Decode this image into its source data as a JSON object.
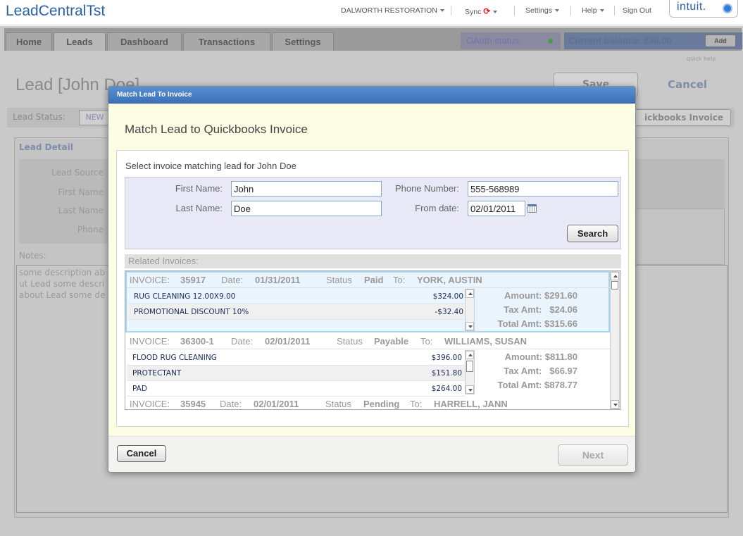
{
  "app_title": "LeadCentralTst",
  "topnav": {
    "company": "DALWORTH RESTORATION",
    "sync": "Sync",
    "settings": "Settings",
    "help": "Help",
    "sign_out": "Sign Out",
    "logo": "intuit."
  },
  "nav_tabs": [
    "Home",
    "Leads",
    "Dashboard",
    "Transactions",
    "Settings"
  ],
  "oauth_label": "OAuth status:",
  "balance": {
    "label": "Current balance:",
    "value": "$38.00",
    "add": "Add"
  },
  "quick_help": "quick help",
  "background": {
    "lead_title": "Lead [John Doe]",
    "save": "Save",
    "cancel": "Cancel",
    "lead_status_label": "Lead Status:",
    "lead_status_value": "NEW",
    "qb_invoice": "ickbooks Invoice",
    "lead_detail": "Lead Detail",
    "fields": [
      "Lead Source",
      "First Name",
      "Last Name",
      "Phone"
    ],
    "notes_label": "Notes:",
    "notes_lines": [
      "some description ab",
      "ut Lead some descri",
      "about Lead some de"
    ]
  },
  "modal": {
    "title": "Match Lead To Invoice",
    "heading": "Match Lead to Quickbooks Invoice",
    "select_label": "Select invoice matching lead for John Doe",
    "first_name_label": "First Name:",
    "first_name": "John",
    "last_name_label": "Last Name:",
    "last_name": "Doe",
    "phone_label": "Phone Number:",
    "phone": "555-568989",
    "from_date_label": "From date:",
    "from_date": "02/01/2011",
    "search": "Search",
    "related_label": "Related Invoices:",
    "cancel": "Cancel",
    "next": "Next"
  },
  "labels": {
    "invoice": "INVOICE:",
    "date": "Date:",
    "status": "Status",
    "to": "To:",
    "amount": "Amount:",
    "tax": "Tax Amt:",
    "total": "Total Amt:"
  },
  "invoices": [
    {
      "number": "35917",
      "date": "01/31/2011",
      "status": "Paid",
      "to": "YORK, AUSTIN",
      "lines": [
        {
          "desc": "RUG CLEANING 12.00X9.00",
          "amount": "$324.00"
        },
        {
          "desc": "PROMOTIONAL DISCOUNT  10%",
          "amount": "-$32.40"
        }
      ],
      "amount": "$291.60",
      "tax": "$24.06",
      "total": "$315.66"
    },
    {
      "number": "36300-1",
      "date": "02/01/2011",
      "status": "Payable",
      "to": "WILLIAMS, SUSAN",
      "lines": [
        {
          "desc": "FLOOD RUG CLEANING",
          "amount": "$396.00"
        },
        {
          "desc": "PROTECTANT",
          "amount": "$151.80"
        },
        {
          "desc": "PAD",
          "amount": "$264.00"
        }
      ],
      "amount": "$811.80",
      "tax": "$66.97",
      "total": "$878.77"
    },
    {
      "number": "35945",
      "date": "02/01/2011",
      "status": "Pending",
      "to": "HARRELL, JANN"
    }
  ]
}
